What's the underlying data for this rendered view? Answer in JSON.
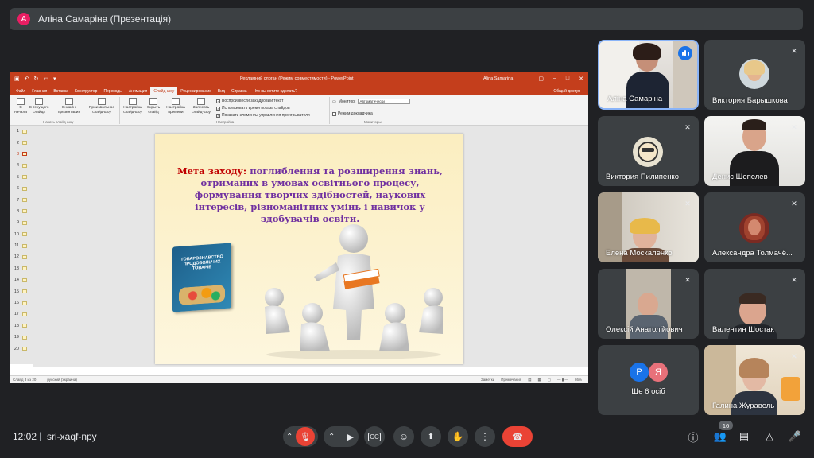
{
  "presenter_bar": {
    "initial": "A",
    "title": "Аліна Самаріна (Презентація)"
  },
  "powerpoint": {
    "window_title": "Рекламний слоган (Режим совместимости) - PowerPoint",
    "user": "Alina Samarina",
    "tabs": [
      "Файл",
      "Главная",
      "Вставка",
      "Конструктор",
      "Переходы",
      "Анимация",
      "Слайд-шоу",
      "Рецензирование",
      "Вид",
      "Справка",
      "Что вы хотите сделать?"
    ],
    "active_tab": "Слайд-шоу",
    "share_label": "Общий доступ",
    "ribbon": {
      "from_start": "С начала",
      "from_current": "С текущего слайда",
      "online": "Онлайн-презентация",
      "custom": "Произвольное слайд-шоу",
      "group_start": "Начать слайд-шоу",
      "setup": "Настройка слайд-шоу",
      "hide": "Скрыть слайд",
      "rehearse": "Настройка времени",
      "record": "Записать слайд-шоу",
      "chk_narration": "Воспроизвести закадровый текст",
      "chk_timings": "Использовать время показа слайдов",
      "chk_controls": "Показать элементы управления проигрывателя",
      "group_setup": "Настройка",
      "monitor_label": "Монитор:",
      "monitor_value": "Автоматически",
      "presenter_view": "Режим докладчика",
      "group_monitors": "Мониторы"
    },
    "slide_numbers": [
      "1",
      "2",
      "3",
      "4",
      "5",
      "6",
      "7",
      "8",
      "9",
      "10",
      "11",
      "12",
      "13",
      "14",
      "15",
      "16",
      "17",
      "18",
      "19",
      "20"
    ],
    "active_slide": "3",
    "slide": {
      "lead": "Мета заходу:",
      "text": "поглиблення та розширення знань, отриманих в умовах освітнього процесу, формування творчих здібностей, наукових інтересів, різноманітних умінь і навичок у здобувачів освіти.",
      "book_title": "ТОВАРОЗНАВСТВО ПРОДОВОЛЬЧИХ ТОВАРІВ"
    },
    "status": {
      "slide_of": "Слайд 3 из 20",
      "language": "русский (Украина)",
      "notes": "Заметки",
      "comments": "Примечания",
      "zoom": "86%"
    }
  },
  "participants": [
    {
      "name": "Аліна Самаріна",
      "speaking": true
    },
    {
      "name": "Виктория Барышкова",
      "muted": true
    },
    {
      "name": "Виктория Пилипенко",
      "muted": true
    },
    {
      "name": "Денис Шепелев",
      "muted": true
    },
    {
      "name": "Елена Москаленко",
      "muted": true
    },
    {
      "name": "Александра Толмачё...",
      "muted": true
    },
    {
      "name": "Олексій Анатолійович",
      "muted": true
    },
    {
      "name": "Валентин Шостак",
      "muted": true
    },
    {
      "name": "Ще 6 осіб",
      "initials": [
        "Р",
        "Я"
      ]
    },
    {
      "name": "Галина Журавель",
      "muted": true
    }
  ],
  "bottom_bar": {
    "time": "12:02",
    "separator": "|",
    "meeting_code": "sri-xaqf-npy",
    "participant_count": "16"
  },
  "colors": {
    "background": "#202124",
    "tile": "#3c4043",
    "ppt_accent": "#c43e1c",
    "hangup": "#ea4335",
    "speaking": "#1a73e8"
  }
}
